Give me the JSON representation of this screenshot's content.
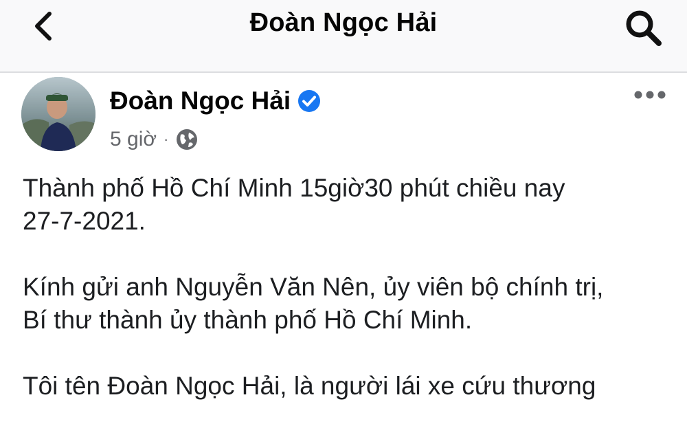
{
  "nav": {
    "title": "Đoàn Ngọc Hải",
    "back_icon": "chevron-left-icon",
    "search_icon": "search-icon"
  },
  "post": {
    "author": "Đoàn Ngọc Hải",
    "verified_icon": "verified-badge-icon",
    "time": "5 giờ",
    "separator": "·",
    "audience_icon": "globe-icon",
    "more_icon": "more-options-icon",
    "paragraphs": [
      {
        "lines": [
          "Thành phố Hồ Chí Minh 15giờ30 phút chiều nay",
          "27-7-2021."
        ]
      },
      {
        "lines": [
          "Kính gửi anh Nguyễn Văn Nên, ủy viên bộ chính trị,",
          "Bí thư thành ủy thành phố Hồ Chí Minh."
        ]
      },
      {
        "lines": [
          "Tôi tên Đoàn Ngọc Hải, là người lái xe cứu thương"
        ]
      }
    ]
  },
  "colors": {
    "verified_blue": "#1877f2",
    "secondary_text": "#65676b",
    "primary_text": "#050505"
  }
}
